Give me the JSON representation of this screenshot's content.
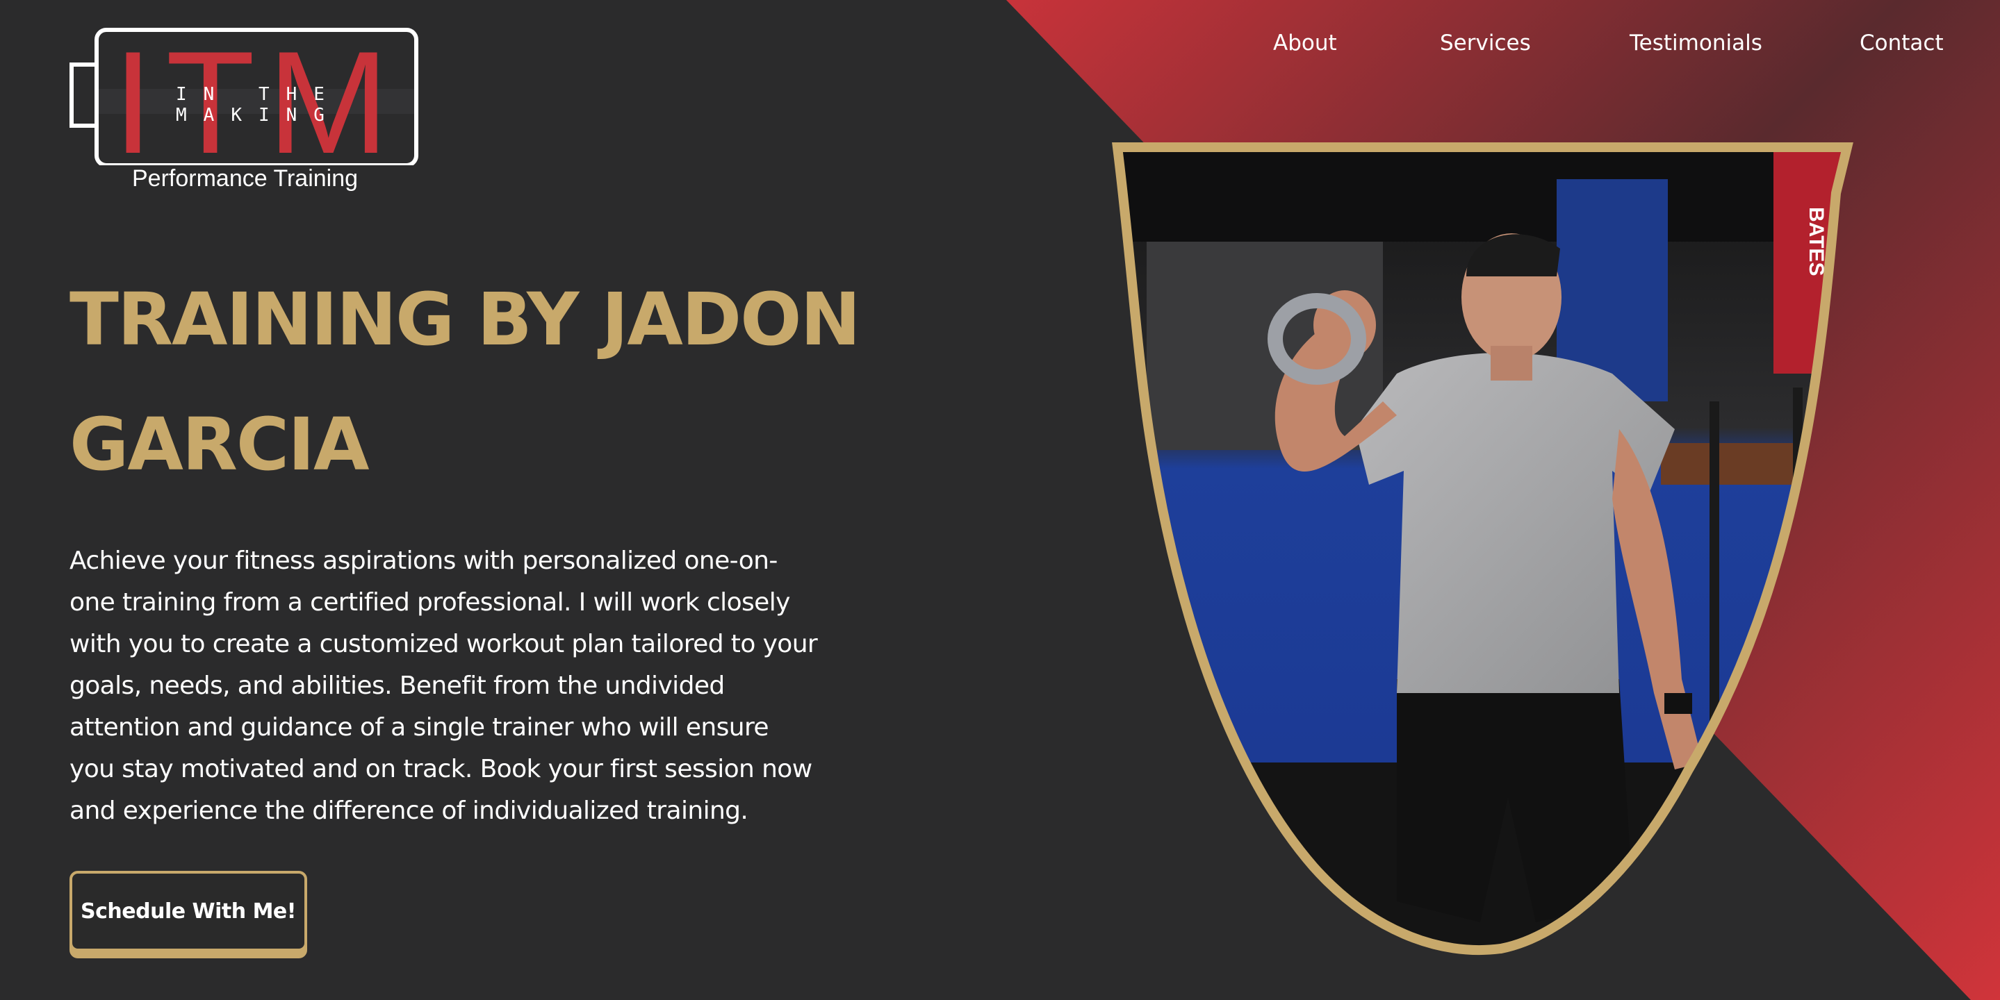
{
  "nav": {
    "items": [
      {
        "label": "About"
      },
      {
        "label": "Services"
      },
      {
        "label": "Testimonials"
      },
      {
        "label": "Contact"
      }
    ]
  },
  "logo": {
    "letters": "ITM",
    "tagline": "IN THE MAKING",
    "subtitle": "Performance Training"
  },
  "hero": {
    "title": "TRAINING BY JADON GARCIA",
    "body": "Achieve your fitness aspirations with personalized one-on-one training from a certified professional. I will work closely with you to create a customized workout plan tailored to your goals, needs, and abilities. Benefit from the undivided attention and guidance of a single trainer who will ensure you stay motivated and on track. Book your first session now and experience the difference of individualized training.",
    "cta_label": "Schedule With Me!"
  },
  "photo": {
    "banner_text": "BATES"
  },
  "colors": {
    "background": "#2b2b2c",
    "gold": "#c8a96b",
    "red": "#c8333a"
  }
}
